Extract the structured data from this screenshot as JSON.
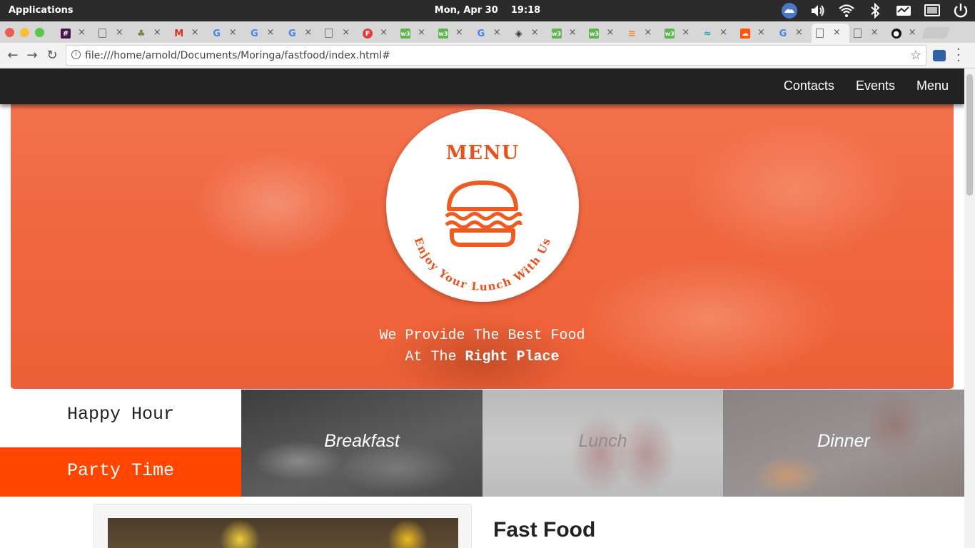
{
  "os": {
    "apps_label": "Applications",
    "clock": "Mon, Apr 30    19:18",
    "tray_icons": [
      "weather-icon",
      "volume-icon",
      "wifi-icon",
      "bluetooth-icon",
      "activity-icon",
      "display-icon",
      "power-icon"
    ]
  },
  "browser": {
    "tabs": [
      {
        "icon": "slack-icon",
        "color": "#4a154b",
        "glyph": "#"
      },
      {
        "icon": "page-icon",
        "color": "#777777",
        "glyph": ""
      },
      {
        "icon": "tree-icon",
        "color": "#6d8b3a",
        "glyph": ""
      },
      {
        "icon": "gmail-icon",
        "color": "#d93025",
        "glyph": "M"
      },
      {
        "icon": "google-icon",
        "color": "#4285f4",
        "glyph": "G"
      },
      {
        "icon": "google-icon",
        "color": "#4285f4",
        "glyph": "G"
      },
      {
        "icon": "google-icon",
        "color": "#4285f4",
        "glyph": "G"
      },
      {
        "icon": "page-icon",
        "color": "#777777",
        "glyph": ""
      },
      {
        "icon": "f-icon",
        "color": "#e03a3a",
        "glyph": "F"
      },
      {
        "icon": "w3-icon",
        "color": "#5fb44f",
        "glyph": "w3"
      },
      {
        "icon": "w3-icon",
        "color": "#5fb44f",
        "glyph": "w3"
      },
      {
        "icon": "google-icon",
        "color": "#4285f4",
        "glyph": "G"
      },
      {
        "icon": "codepen-icon",
        "color": "#333333",
        "glyph": "◈"
      },
      {
        "icon": "w3-icon",
        "color": "#5fb44f",
        "glyph": "w3"
      },
      {
        "icon": "w3-icon",
        "color": "#5fb44f",
        "glyph": "w3"
      },
      {
        "icon": "stackoverflow-icon",
        "color": "#f48024",
        "glyph": "≡"
      },
      {
        "icon": "w3-icon",
        "color": "#5fb44f",
        "glyph": "w3"
      },
      {
        "icon": "tailwind-icon",
        "color": "#2aa6b9",
        "glyph": "≈"
      },
      {
        "icon": "soundcloud-icon",
        "color": "#ff5500",
        "glyph": "☁"
      },
      {
        "icon": "google-icon",
        "color": "#4285f4",
        "glyph": "G"
      },
      {
        "icon": "page-icon",
        "color": "#777777",
        "glyph": "",
        "active": true
      },
      {
        "icon": "page-icon",
        "color": "#777777",
        "glyph": ""
      },
      {
        "icon": "github-icon",
        "color": "#111111",
        "glyph": "●"
      }
    ],
    "url": "file:///home/arnold/Documents/Moringa/fastfood/index.html#"
  },
  "site": {
    "nav": [
      "Contacts",
      "Events",
      "Menu"
    ],
    "logo_title": "MENU",
    "logo_arc_text": "Enjoy Your Lunch With Us",
    "tagline_line1": "We Provide The Best Food",
    "tagline_line2_prefix": "At The ",
    "tagline_line2_bold": "Right Place",
    "happy_hour": "Happy Hour",
    "party_time": "Party Time",
    "meals": [
      "Breakfast",
      "Lunch",
      "Dinner"
    ],
    "section_title": "Fast Food",
    "accent_color": "#ff4500"
  }
}
